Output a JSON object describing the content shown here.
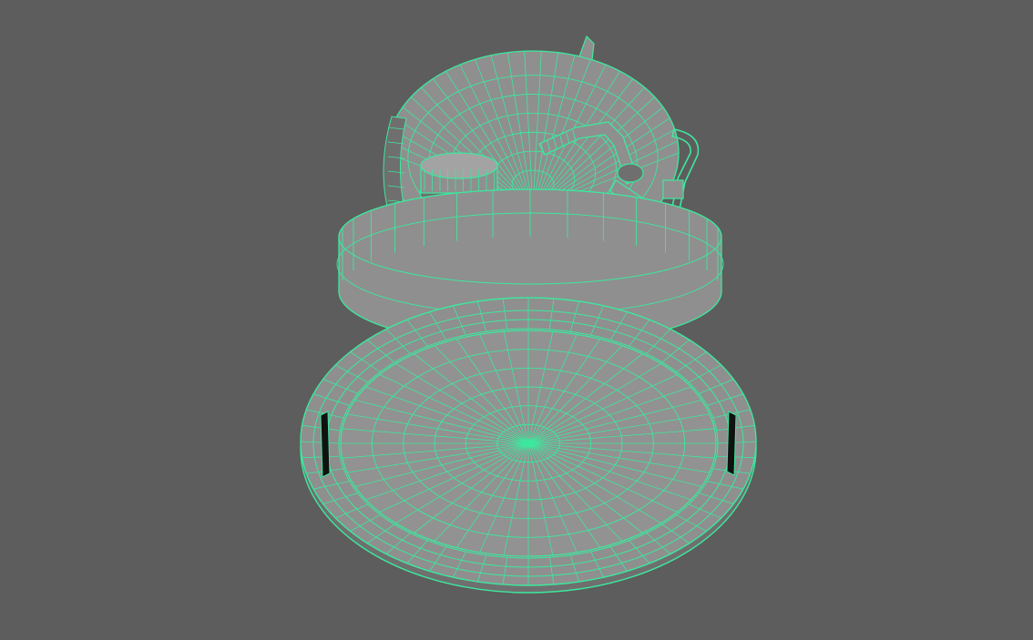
{
  "viewport": {
    "background_color": "#5d5d5d",
    "wireframe_color": "#3de89e",
    "shaded_color": "#8f8f8f",
    "shade_dark_color": "#6f6f6f",
    "selection_state": "selected",
    "display_mode": "wireframe-on-shaded"
  },
  "model": {
    "object_type": "round-lamp-housing",
    "parts": [
      "dish",
      "lower-ring",
      "rim",
      "knob",
      "bent-pipe",
      "bracket"
    ]
  }
}
